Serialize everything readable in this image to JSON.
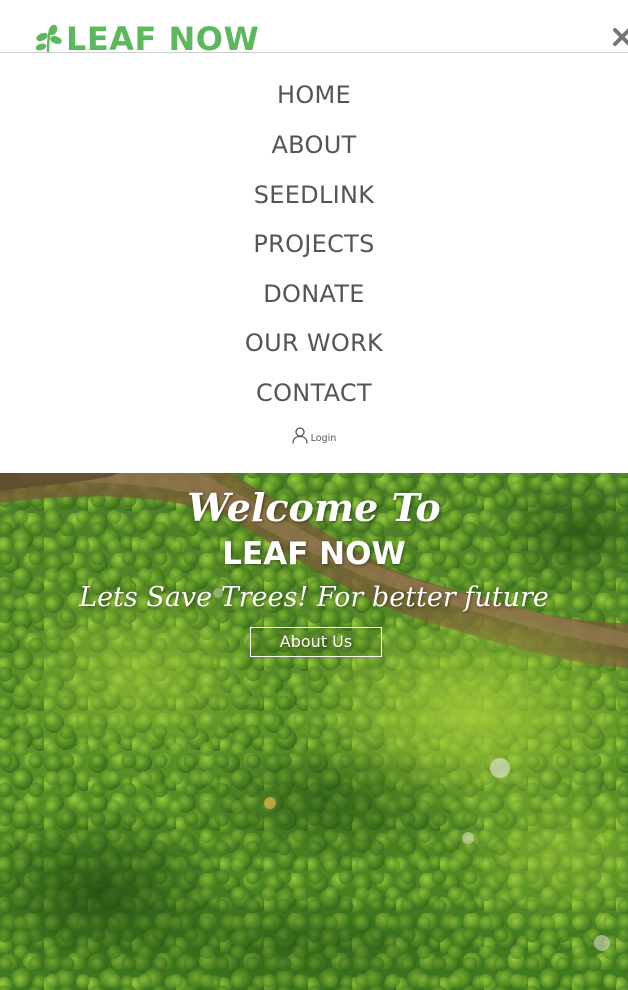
{
  "header": {
    "brand": "LEAF NOW",
    "brand_color": "#5cb85c",
    "logo_icon": "leaf-sprig-icon",
    "close_icon": "close-icon"
  },
  "nav": {
    "items": [
      {
        "label": "HOME"
      },
      {
        "label": "ABOUT"
      },
      {
        "label": "SEEDLINK"
      },
      {
        "label": "PROJECTS"
      },
      {
        "label": "DONATE"
      },
      {
        "label": "OUR WORK"
      },
      {
        "label": "CONTACT"
      }
    ],
    "login": {
      "icon": "user-icon",
      "label": "Login"
    },
    "text_color": "#555555"
  },
  "hero": {
    "welcome": "Welcome To",
    "brand": "LEAF NOW",
    "tagline": "Lets Save Trees! For better future",
    "button_label": "About Us",
    "background": "aerial forest photo"
  }
}
